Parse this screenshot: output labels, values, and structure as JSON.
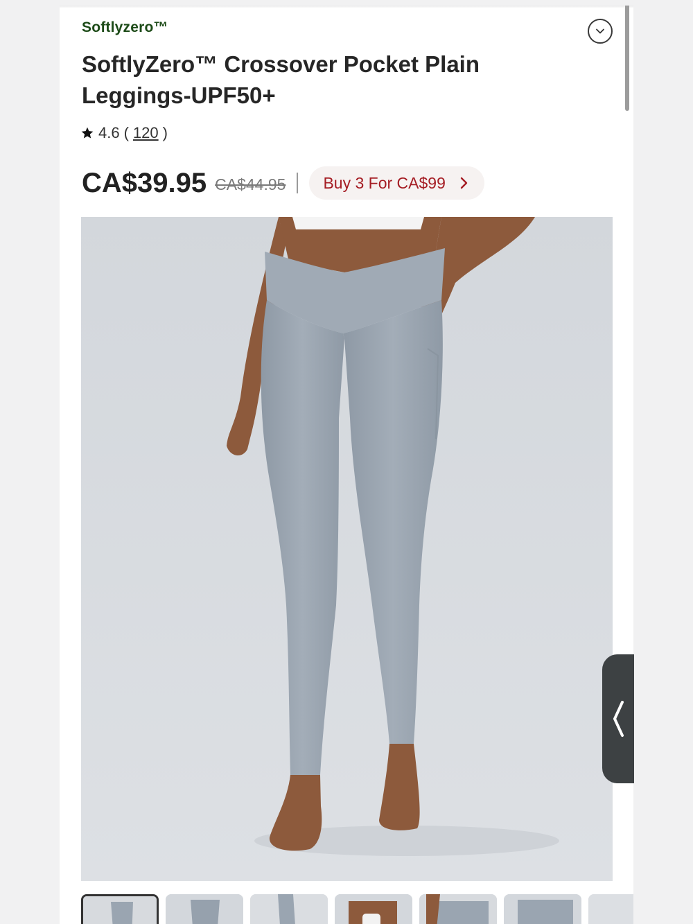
{
  "product": {
    "brand": "Softlyzero™",
    "title": "SoftlyZero™ Crossover Pocket Plain Leggings-UPF50+",
    "rating": "4.6",
    "reviews_open": "(",
    "reviews_count": "120",
    "reviews_close": ")",
    "price": "CA$39.95",
    "original_price": "CA$44.95",
    "promo": "Buy 3 For CA$99"
  },
  "icons": {
    "collapse": "chevron-down-circle-icon",
    "star": "star-icon",
    "promo_arrow": "chevron-right-icon",
    "side_tab": "chevron-left-icon"
  },
  "colors": {
    "brand": "#1d4b18",
    "promo_text": "#a51d24",
    "promo_bg": "#f6f2f1",
    "legging": "#9aa5b1",
    "photo_bg": "#d5d9de",
    "skin": "#8d5a3c"
  },
  "thumbnails_count": 7
}
